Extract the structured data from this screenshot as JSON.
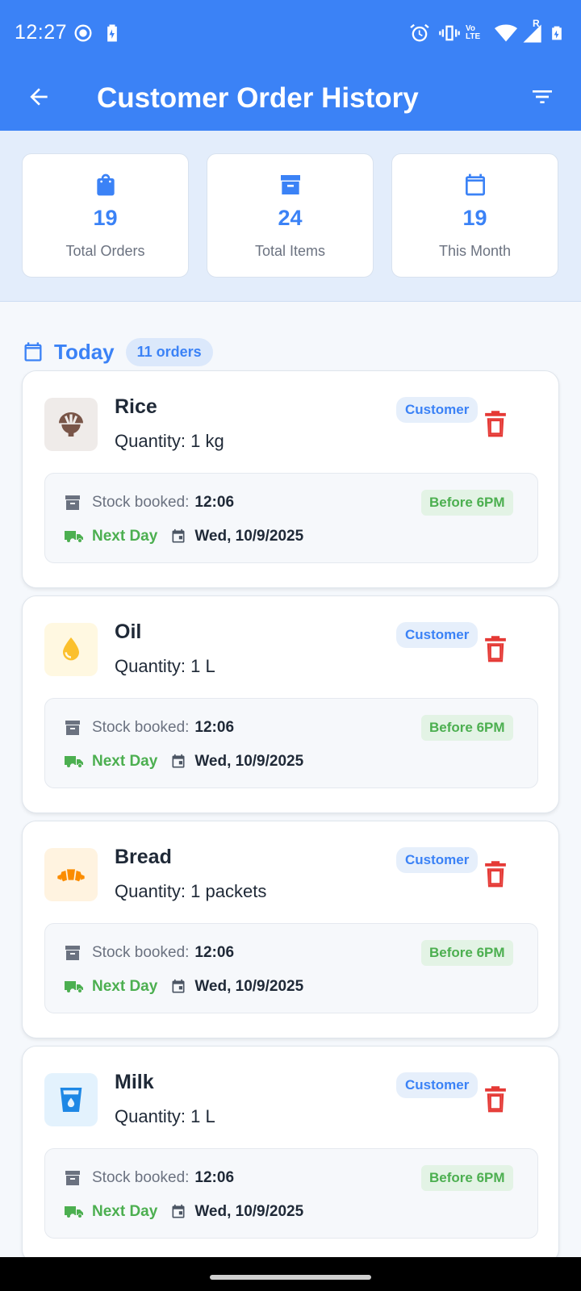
{
  "status_bar": {
    "time": "12:27",
    "network_label": "Vo LTE",
    "roaming_label": "R"
  },
  "app_bar": {
    "title": "Customer Order History"
  },
  "stats": [
    {
      "icon": "shopping-bag-icon",
      "value": "19",
      "label": "Total Orders"
    },
    {
      "icon": "archive-box-icon",
      "value": "24",
      "label": "Total Items"
    },
    {
      "icon": "calendar-icon",
      "value": "19",
      "label": "This Month"
    }
  ],
  "section": {
    "title": "Today",
    "count_label": "11 orders"
  },
  "orders": [
    {
      "name": "Rice",
      "quantity": "Quantity: 1 kg",
      "icon": "rice-bowl-icon",
      "icon_color": "#795548",
      "icon_bg": "#efebe9",
      "type": "Customer",
      "stock_label": "Stock booked:",
      "stock_time": "12:06",
      "timing": "Before 6PM",
      "delivery": "Next Day",
      "date": "Wed, 10/9/2025"
    },
    {
      "name": "Oil",
      "quantity": "Quantity: 1 L",
      "icon": "oil-drop-icon",
      "icon_color": "#fbc02d",
      "icon_bg": "#fff8e1",
      "type": "Customer",
      "stock_label": "Stock booked:",
      "stock_time": "12:06",
      "timing": "Before 6PM",
      "delivery": "Next Day",
      "date": "Wed, 10/9/2025"
    },
    {
      "name": "Bread",
      "quantity": "Quantity: 1 packets",
      "icon": "croissant-icon",
      "icon_color": "#fb8c00",
      "icon_bg": "#fff3e0",
      "type": "Customer",
      "stock_label": "Stock booked:",
      "stock_time": "12:06",
      "timing": "Before 6PM",
      "delivery": "Next Day",
      "date": "Wed, 10/9/2025"
    },
    {
      "name": "Milk",
      "quantity": "Quantity: 1 L",
      "icon": "milk-glass-icon",
      "icon_color": "#1e88e5",
      "icon_bg": "#e3f2fd",
      "type": "Customer",
      "stock_label": "Stock booked:",
      "stock_time": "12:06",
      "timing": "Before 6PM",
      "delivery": "Next Day",
      "date": "Wed, 10/9/2025"
    }
  ],
  "colors": {
    "primary": "#3b82f6",
    "success": "#4caf50",
    "danger": "#e53935"
  }
}
